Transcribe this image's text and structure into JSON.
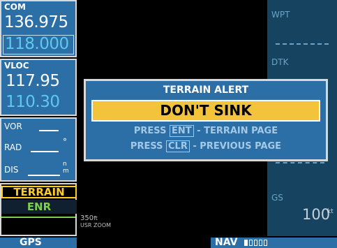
{
  "com": {
    "label": "COM",
    "active": "136.975",
    "standby": "118.000"
  },
  "vloc": {
    "label": "VLOC",
    "active": "117.95",
    "standby": "110.30"
  },
  "vor": {
    "label": "VOR",
    "rad_label": "RAD",
    "dis_label": "DIS",
    "deg_symbol": "°",
    "unit_top": "n",
    "unit_bottom": "m"
  },
  "cdi": {
    "mode_label": "TERRAIN",
    "phase": "ENR"
  },
  "right": {
    "wpt_label": "WPT",
    "dtk_label": "DTK",
    "gs_label": "GS",
    "gs_value": "100",
    "gs_unit": "kt"
  },
  "map": {
    "range_value": "350",
    "range_unit": "ft",
    "range_mode": "USR ZOOM"
  },
  "status": {
    "left": "GPS",
    "nav": "NAV"
  },
  "alert": {
    "title": "TERRAIN ALERT",
    "message": "DON'T SINK",
    "line1_pre": "PRESS ",
    "line1_key": "ENT",
    "line1_post": " - TERRAIN PAGE",
    "line2_pre": "PRESS ",
    "line2_key": "CLR",
    "line2_post": " - PREVIOUS PAGE"
  },
  "colors": {
    "panel_blue": "#2c6ea6",
    "alert_yellow": "#f3c33b",
    "standby_cyan": "#5fc8ec",
    "terrain_yellow": "#ffcc22",
    "phase_green": "#7cd04a"
  }
}
